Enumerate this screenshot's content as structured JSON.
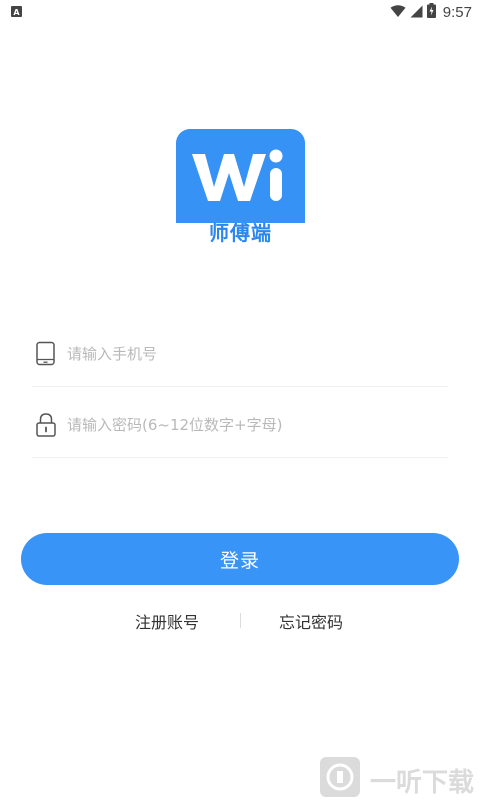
{
  "status_bar": {
    "time": "9:57",
    "icons": [
      "notification-a-icon",
      "wifi-icon",
      "signal-icon",
      "battery-charging-icon"
    ]
  },
  "logo": {
    "mark": "Wi",
    "caption": "师傅端",
    "color": "#3792f5"
  },
  "form": {
    "phone": {
      "placeholder": "请输入手机号",
      "value": "",
      "icon": "phone-icon"
    },
    "password": {
      "placeholder": "请输入密码(6~12位数字+字母)",
      "value": "",
      "icon": "lock-icon"
    }
  },
  "login_button": {
    "label": "登录",
    "color": "#3994f7"
  },
  "links": {
    "register": "注册账号",
    "forgot_password": "忘记密码"
  },
  "watermark": {
    "text": "一听下载"
  }
}
